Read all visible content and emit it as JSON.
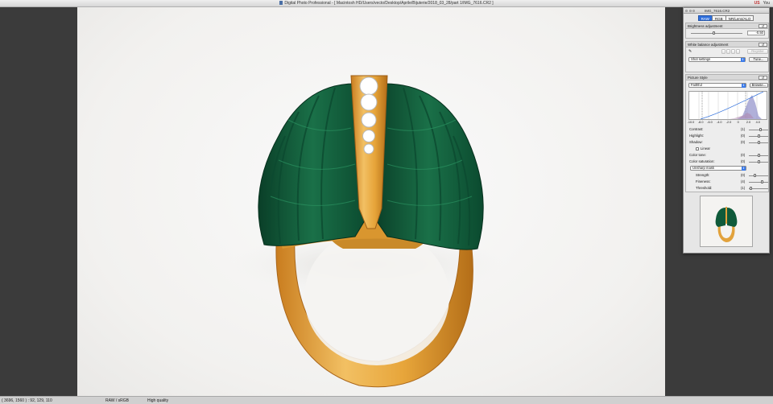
{
  "window": {
    "title": "Digital Photo Professional - [ Macintosh HD/Users/vecto/Desktop/Aprile/Bijuterie/2018_03_28/part 1/IMG_7616.CR2 ]",
    "menu_flag": "US",
    "menu_user": "You"
  },
  "status_bar": {
    "coords": "( 3696, 1560 ) : 92, 129, 110",
    "format": "RAW / sRGB",
    "quality": "High quality"
  },
  "palette": {
    "title": "IMG_7616.CR2",
    "tabs": [
      {
        "label": "RAW",
        "active": true
      },
      {
        "label": "RGB",
        "active": false
      },
      {
        "label": "NR/Lens/ALO",
        "active": false
      }
    ],
    "reset_icon": "↺",
    "brightness": {
      "label": "Brightness adjustment",
      "value": "-0.50",
      "fraction": 0.45
    },
    "white_balance": {
      "label": "White balance adjustment",
      "register_label": "Register",
      "setting": "Shot settings",
      "tune_label": "Tune..."
    },
    "picture_style": {
      "label": "Picture Style",
      "style": "Faithful",
      "browse_label": "Browse...",
      "histogram_ticks": [
        "-10.0",
        "-8.0",
        "-6.0",
        "-4.0",
        "-2.0",
        "0",
        "2.0",
        "4.0"
      ],
      "params": [
        {
          "label": "Contrast:",
          "value": "(1)",
          "fraction": 0.6
        },
        {
          "label": "Highlight:",
          "value": "(0)",
          "fraction": 0.5
        },
        {
          "label": "Shadow:",
          "value": "(0)",
          "fraction": 0.5
        }
      ],
      "linear_label": "Linear",
      "color_params": [
        {
          "label": "Color tone:",
          "value": "(0)",
          "fraction": 0.5
        },
        {
          "label": "Color saturation:",
          "value": "(0)",
          "fraction": 0.5
        }
      ],
      "sharpness_mode": "Unsharp mask",
      "sharp_params": [
        {
          "label": "Strength:",
          "value": "(0)",
          "fraction": 0.3
        },
        {
          "label": "Fineness:",
          "value": "(4)",
          "fraction": 0.7
        },
        {
          "label": "Threshold:",
          "value": "(1)",
          "fraction": 0.1
        }
      ]
    }
  },
  "colors": {
    "malachite": "#0f5a3a",
    "malachite_light": "#1f7a50",
    "gold": "#e2a23c",
    "gold_dark": "#b7741c",
    "accent": "#2f6fdc"
  }
}
